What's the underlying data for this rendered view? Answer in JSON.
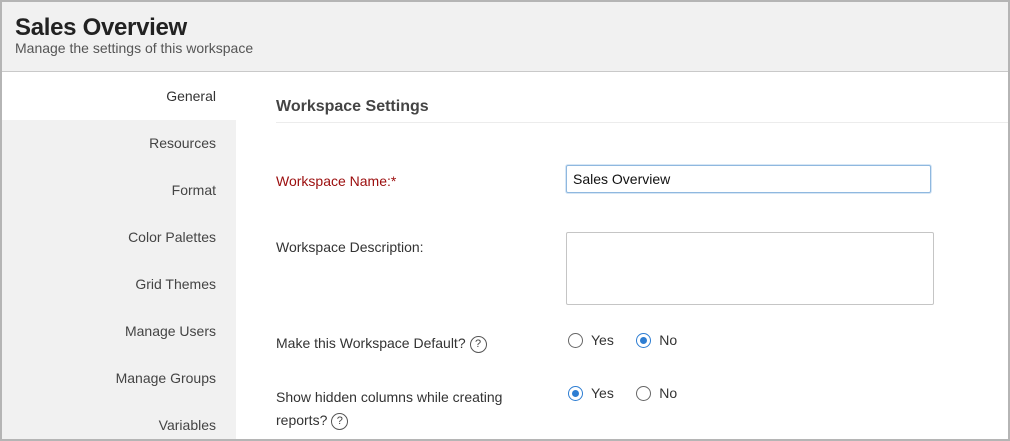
{
  "header": {
    "title": "Sales Overview",
    "subtitle": "Manage the settings of this workspace"
  },
  "sidebar": {
    "items": [
      {
        "label": "General",
        "active": true
      },
      {
        "label": "Resources",
        "active": false
      },
      {
        "label": "Format",
        "active": false
      },
      {
        "label": "Color Palettes",
        "active": false
      },
      {
        "label": "Grid Themes",
        "active": false
      },
      {
        "label": "Manage Users",
        "active": false
      },
      {
        "label": "Manage Groups",
        "active": false
      },
      {
        "label": "Variables",
        "active": false
      }
    ]
  },
  "main": {
    "section_title": "Workspace Settings",
    "workspace_name": {
      "label": "Workspace Name:*",
      "value": "Sales Overview"
    },
    "workspace_description": {
      "label": "Workspace Description:",
      "value": ""
    },
    "default_workspace": {
      "label": "Make this Workspace Default?",
      "help_icon": "?",
      "options": [
        "Yes",
        "No"
      ],
      "selected": "No"
    },
    "hidden_columns": {
      "label_line1": "Show hidden columns while creating",
      "label_line2": "reports?",
      "help_icon": "?",
      "options": [
        "Yes",
        "No"
      ],
      "selected": "Yes"
    }
  },
  "colors": {
    "required_label": "#9b0d0d",
    "radio_accent": "#2d7dd2",
    "sidebar_bg": "#f1f1f1"
  }
}
